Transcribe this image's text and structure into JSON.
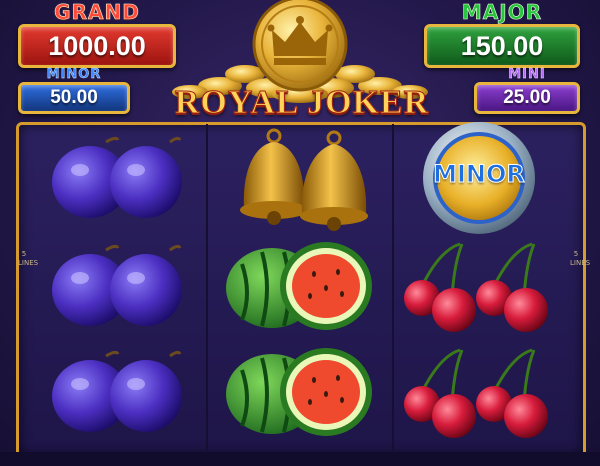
{
  "jackpots": {
    "grand": {
      "label": "GRAND",
      "value": "1000.00"
    },
    "major": {
      "label": "MAJOR",
      "value": "150.00"
    },
    "minor": {
      "label": "MINOR",
      "value": "50.00"
    },
    "mini": {
      "label": "MINI",
      "value": "25.00"
    }
  },
  "logo": {
    "title": "ROYAL JOKER"
  },
  "lines": {
    "left": "5\nLINES",
    "right": "5\nLINES"
  },
  "minor_coin": {
    "label": "MINOR"
  },
  "reels": [
    [
      "plum",
      "plum",
      "plum"
    ],
    [
      "bell",
      "watermelon",
      "watermelon"
    ],
    [
      "minor-coin",
      "cherry",
      "cherry"
    ]
  ],
  "colors": {
    "frame": "#d79a2c",
    "background": "#23184a"
  }
}
